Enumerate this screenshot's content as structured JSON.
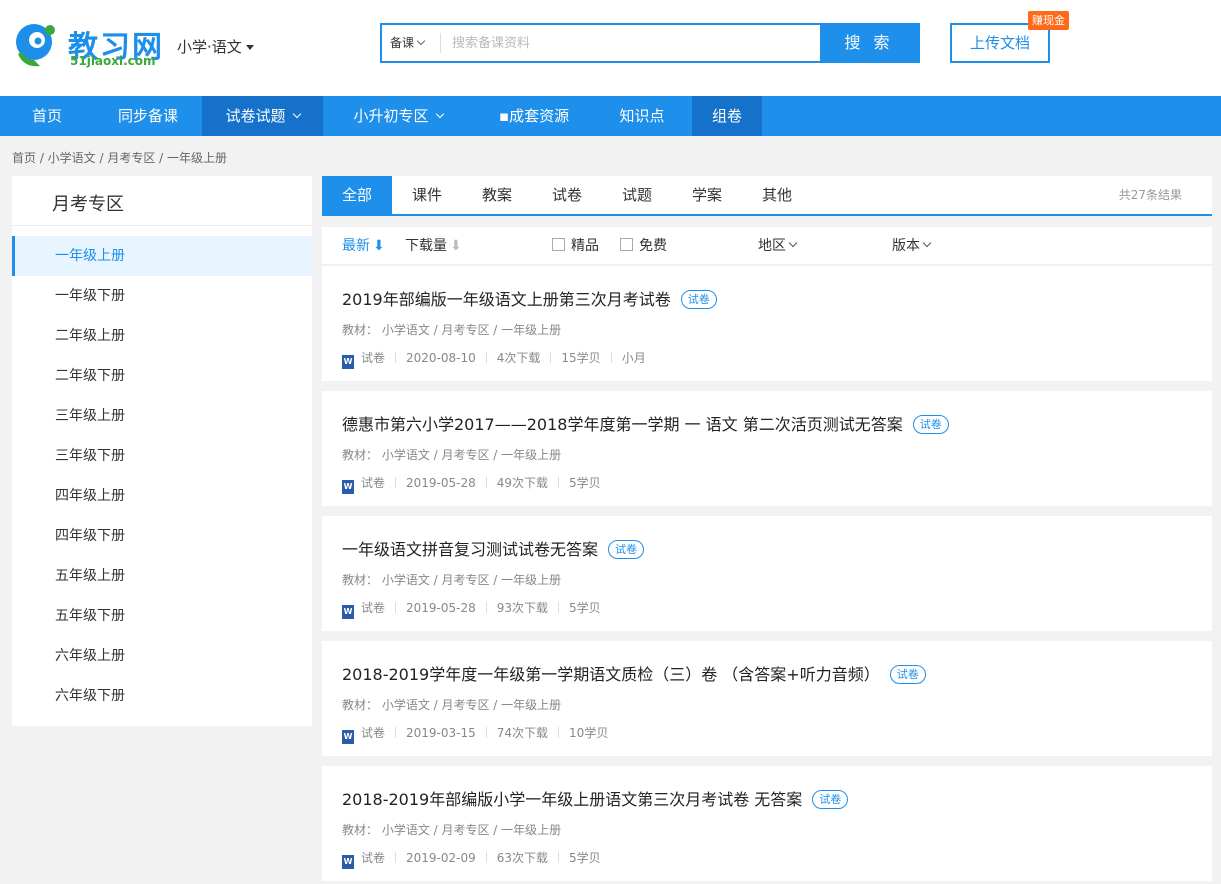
{
  "logo": {
    "name": "教习网",
    "domain": "51jiaoxi.com"
  },
  "subject_selector": {
    "label": "小学·语文"
  },
  "search": {
    "type_label": "备课",
    "placeholder": "搜索备课资料",
    "button_label": "搜 索"
  },
  "upload": {
    "label": "上传文档",
    "badge": "赚现金"
  },
  "nav": {
    "items": [
      {
        "label": "首页"
      },
      {
        "label": "同步备课"
      },
      {
        "label": "试卷试题"
      },
      {
        "label": "小升初专区"
      },
      {
        "label": "▪成套资源"
      },
      {
        "label": "知识点"
      },
      {
        "label": "组卷"
      }
    ]
  },
  "breadcrumb": "首页 / 小学语文 / 月考专区 / 一年级上册",
  "sidebar": {
    "title": "月考专区",
    "items": [
      {
        "label": "一年级上册"
      },
      {
        "label": "一年级下册"
      },
      {
        "label": "二年级上册"
      },
      {
        "label": "二年级下册"
      },
      {
        "label": "三年级上册"
      },
      {
        "label": "三年级下册"
      },
      {
        "label": "四年级上册"
      },
      {
        "label": "四年级下册"
      },
      {
        "label": "五年级上册"
      },
      {
        "label": "五年级下册"
      },
      {
        "label": "六年级上册"
      },
      {
        "label": "六年级下册"
      }
    ]
  },
  "tabs": {
    "items": [
      {
        "label": "全部"
      },
      {
        "label": "课件"
      },
      {
        "label": "教案"
      },
      {
        "label": "试卷"
      },
      {
        "label": "试题"
      },
      {
        "label": "学案"
      },
      {
        "label": "其他"
      }
    ],
    "result_count": "共27条结果"
  },
  "filter": {
    "latest": "最新",
    "downloads": "下载量",
    "premium": "精品",
    "free": "免费",
    "region": "地区",
    "edition": "版本"
  },
  "documents": [
    {
      "title": "2019年部编版一年级语文上册第三次月考试卷",
      "tag": "试卷",
      "path": "教材： 小学语文 / 月考专区 / 一年级上册",
      "type": "试卷",
      "date": "2020-08-10",
      "downloads": "4次下载",
      "price": "15学贝",
      "author": "小月"
    },
    {
      "title": "德惠市第六小学2017——2018学年度第一学期 一 语文 第二次活页测试无答案",
      "tag": "试卷",
      "path": "教材： 小学语文 / 月考专区 / 一年级上册",
      "type": "试卷",
      "date": "2019-05-28",
      "downloads": "49次下载",
      "price": "5学贝"
    },
    {
      "title": "一年级语文拼音复习测试试卷无答案",
      "tag": "试卷",
      "path": "教材： 小学语文 / 月考专区 / 一年级上册",
      "type": "试卷",
      "date": "2019-05-28",
      "downloads": "93次下载",
      "price": "5学贝"
    },
    {
      "title": "2018-2019学年度一年级第一学期语文质检（三）卷 （含答案+听力音频）",
      "tag": "试卷",
      "path": "教材： 小学语文 / 月考专区 / 一年级上册",
      "type": "试卷",
      "date": "2019-03-15",
      "downloads": "74次下载",
      "price": "10学贝"
    },
    {
      "title": "2018-2019年部编版小学一年级上册语文第三次月考试卷 无答案",
      "tag": "试卷",
      "path": "教材： 小学语文 / 月考专区 / 一年级上册",
      "type": "试卷",
      "date": "2019-02-09",
      "downloads": "63次下载",
      "price": "5学贝"
    }
  ],
  "colors": {
    "primary": "#1e8fea",
    "nav_dark": "#1571c9",
    "badge": "#ff6a1a",
    "logo_green": "#3aa83a"
  }
}
